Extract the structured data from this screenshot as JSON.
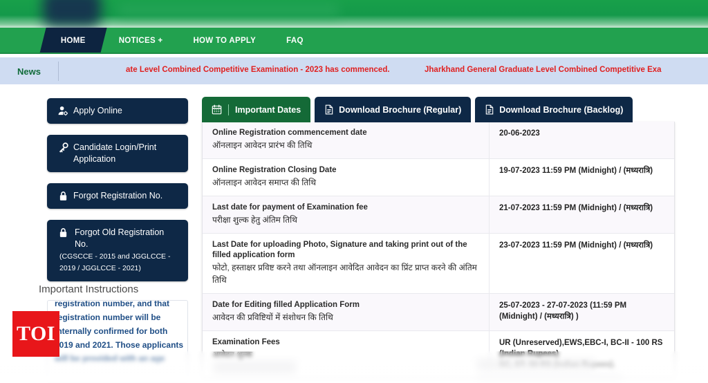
{
  "nav": {
    "items": [
      {
        "label": "HOME",
        "active": true
      },
      {
        "label": "NOTICES +",
        "active": false
      },
      {
        "label": "HOW TO APPLY",
        "active": false
      },
      {
        "label": "FAQ",
        "active": false
      }
    ]
  },
  "news": {
    "label": "News",
    "items": [
      "ate Level Combined Competitive Examination - 2023 has commenced.",
      "Jharkhand General Graduate Level Combined Competitive Exa"
    ]
  },
  "sidebar": {
    "buttons": [
      {
        "label": "Apply Online",
        "sub": "",
        "icon": "person-gear-icon"
      },
      {
        "label": "Candidate Login/Print Application",
        "sub": "",
        "icon": "key-icon"
      },
      {
        "label": "Forgot Registration No.",
        "sub": "",
        "icon": "lock-icon"
      },
      {
        "label": "Forgot Old Registration No.",
        "sub": "(CGSCCE - 2015 and JGGLCCE - 2019 / JGGLCCE - 2021)",
        "icon": "lock-icon"
      }
    ],
    "instructions_title": "Important Instructions",
    "instructions_text": "registration number, and that registration number will be internally confirmed for both 2019 and 2021. Those applicants will be provided with an age"
  },
  "watermark": {
    "logo_text": "TOI"
  },
  "main": {
    "tabs": [
      {
        "label": "Important Dates",
        "icon": "calendar-icon",
        "active": true
      },
      {
        "label": "Download Brochure (Regular)",
        "icon": "document-icon",
        "active": false
      },
      {
        "label": "Download Brochure (Backlog)",
        "icon": "document-icon",
        "active": false
      }
    ],
    "table": {
      "rows": [
        {
          "en": "Online Registration commencement date",
          "hi": "ऑनलाइन आवेदन प्रारंभ की तिथि",
          "value": "20-06-2023"
        },
        {
          "en": "Online Registration Closing Date",
          "hi": "ऑनलाइन आवेदन समाप्त की तिथि",
          "value": "19-07-2023 11:59 PM (Midnight) / (मध्यरात्रि)"
        },
        {
          "en": "Last date for payment of Examination fee",
          "hi": "परीक्षा शुल्क हेतु अंतिम तिथि",
          "value": "21-07-2023 11:59 PM (Midnight) / (मध्यरात्रि)"
        },
        {
          "en": "Last Date for uploading Photo, Signature and taking print out of the filled application form",
          "hi": "फोटो, हस्ताक्षर प्रविष्ट करने तथा ऑनलाइन आवेदित आवेदन का प्रिंट प्राप्त करने की अंतिम तिथि",
          "value": "23-07-2023 11:59 PM (Midnight) / (मध्यरात्रि)"
        },
        {
          "en": "Date for Editing filled Application Form",
          "hi": "आवेदन की प्रविष्टियों में संशोधन कि तिथि",
          "value": "25-07-2023 - 27-07-2023 (11:59 PM (Midnight) / (मध्यरात्रि) )"
        },
        {
          "en": "Examination Fees",
          "hi": "आवेदन शुल्क",
          "value": "UR (Unreserved),EWS,EBC-I, BC-II - 100 RS (Indian Rupees)\nSC, ST- 50 RS (Indian Rupees)."
        }
      ]
    }
  },
  "colors": {
    "nav_green": "#22a14f",
    "dark_navy": "#0e2846",
    "tab_green": "#146a37",
    "news_bg": "#cfdcf2",
    "news_text": "#e02020",
    "toi_red": "#e8161a",
    "instr_blue": "#1f4e86"
  }
}
